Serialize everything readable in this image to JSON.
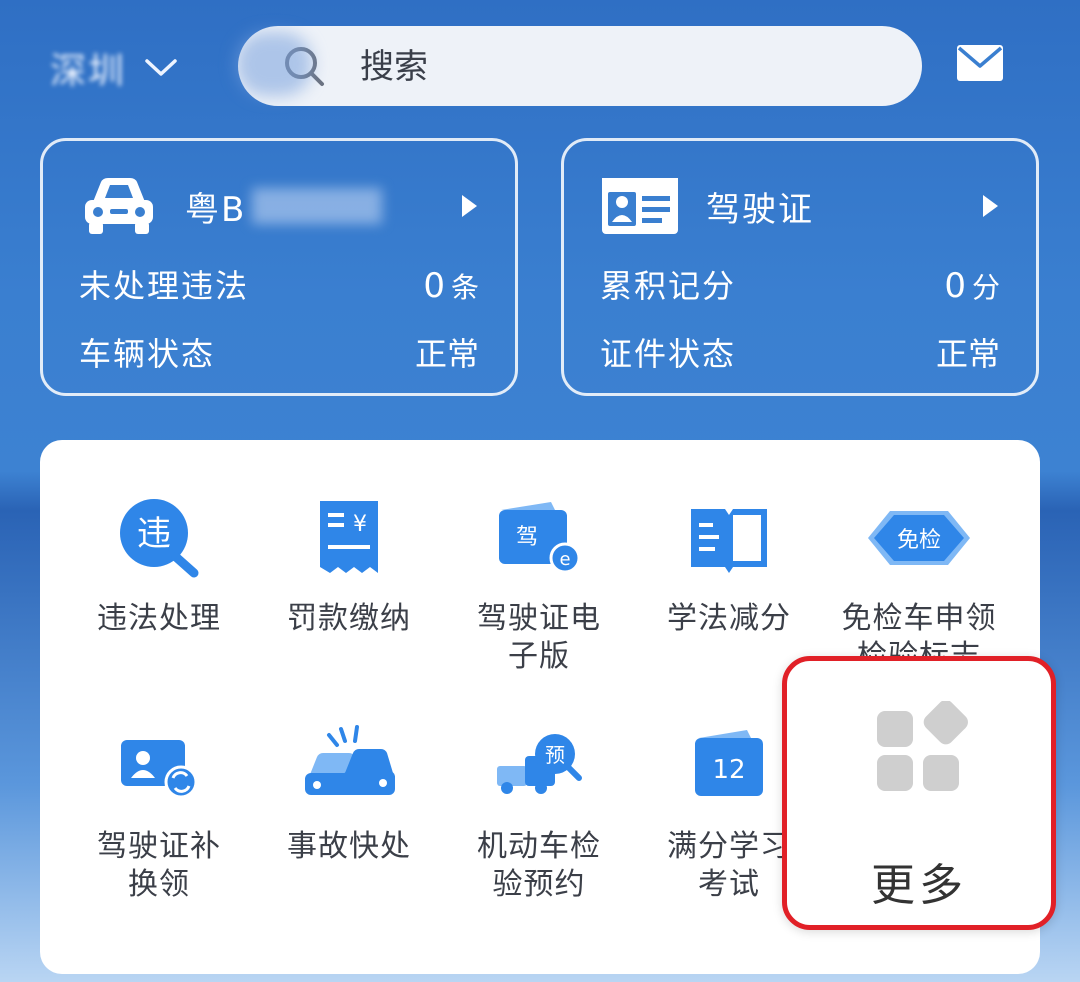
{
  "header": {
    "city": "深圳",
    "search_placeholder": "搜索"
  },
  "vehicle_card": {
    "plate": "粤B",
    "rows": [
      {
        "label": "未处理违法",
        "value": "0",
        "unit": "条"
      },
      {
        "label": "车辆状态",
        "value": "正常",
        "unit": ""
      }
    ]
  },
  "license_card": {
    "title": "驾驶证",
    "rows": [
      {
        "label": "累积记分",
        "value": "0",
        "unit": "分"
      },
      {
        "label": "证件状态",
        "value": "正常",
        "unit": ""
      }
    ]
  },
  "services": [
    {
      "id": "violation",
      "icon_text": "违",
      "label_lines": [
        "违法处理"
      ]
    },
    {
      "id": "fine",
      "icon_text": "¥",
      "label_lines": [
        "罚款缴纳"
      ]
    },
    {
      "id": "elicense",
      "icon_text": "驾",
      "label_lines": [
        "驾驶证电",
        "子版"
      ]
    },
    {
      "id": "study",
      "icon_text": "",
      "label_lines": [
        "学法减分"
      ]
    },
    {
      "id": "exempt",
      "icon_text": "免检",
      "label_lines": [
        "免检车申领",
        "检验标志"
      ]
    },
    {
      "id": "renew",
      "icon_text": "",
      "label_lines": [
        "驾驶证补",
        "换领"
      ]
    },
    {
      "id": "accident",
      "icon_text": "",
      "label_lines": [
        "事故快处"
      ]
    },
    {
      "id": "inspect",
      "icon_text": "预",
      "label_lines": [
        "机动车检",
        "验预约"
      ]
    },
    {
      "id": "fullscore",
      "icon_text": "12",
      "label_lines": [
        "满分学习",
        "考试"
      ]
    }
  ],
  "more": {
    "label": "更多"
  },
  "colors": {
    "background": "#3a7fd0",
    "icon_blue": "#2f86e8",
    "icon_light": "#7fb8f5",
    "highlight_border": "#e12027",
    "more_icon_gray": "#cfcfcf"
  }
}
